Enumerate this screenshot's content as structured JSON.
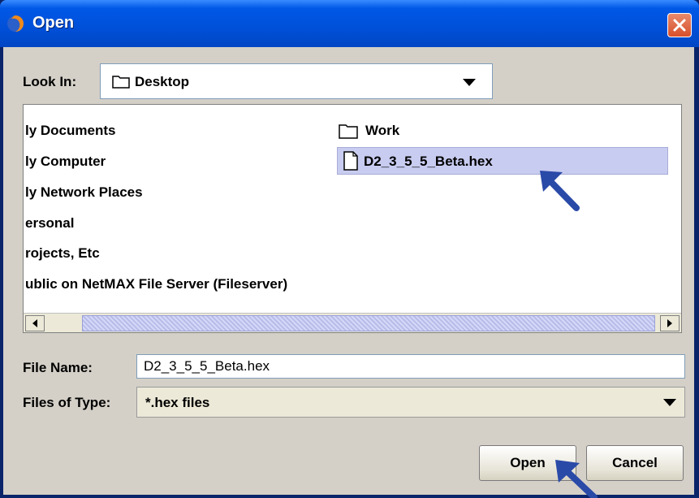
{
  "window": {
    "title": "Open",
    "icon": "firefox-icon"
  },
  "look_in": {
    "label": "Look In:",
    "value": "Desktop"
  },
  "toolbar": {
    "buttons": [
      "up-one-level-icon",
      "home-icon",
      "new-folder-icon",
      "list-view-icon",
      "details-view-icon"
    ]
  },
  "files": {
    "left_column": [
      "ly Documents",
      "ly Computer",
      "ly Network Places",
      "ersonal",
      "rojects, Etc",
      "ublic on NetMAX File Server (Fileserver)"
    ],
    "right_column": [
      {
        "name": "Work",
        "icon": "folder-icon",
        "selected": false
      },
      {
        "name": "D2_3_5_5_Beta.hex",
        "icon": "file-icon",
        "selected": true
      }
    ]
  },
  "file_name": {
    "label": "File Name:",
    "value": "D2_3_5_5_Beta.hex"
  },
  "file_type": {
    "label": "Files of Type:",
    "value": "*.hex files"
  },
  "buttons": {
    "open": "Open",
    "cancel": "Cancel"
  },
  "colors": {
    "accent_arrow": "#2a4aa8",
    "selection": "#c8ccf0",
    "titlebar": "#0054e3"
  }
}
